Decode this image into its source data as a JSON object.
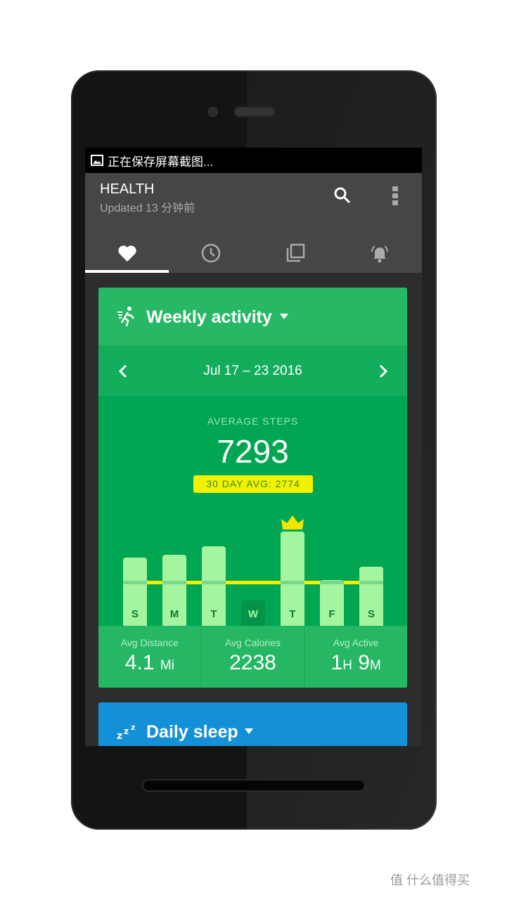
{
  "status_bar": {
    "notification": "正在保存屏幕截图...",
    "icon": "image-icon"
  },
  "app_bar": {
    "title": "HEALTH",
    "subtitle": "Updated 13 分钟前",
    "actions": [
      "search-icon",
      "more-vert-icon"
    ]
  },
  "tabs": [
    {
      "icon": "heart-icon",
      "selected": true
    },
    {
      "icon": "clock-icon",
      "selected": false
    },
    {
      "icon": "layers-icon",
      "selected": false
    },
    {
      "icon": "alarm-icon",
      "selected": false
    }
  ],
  "activity_card": {
    "title": "Weekly activity",
    "date_range": "Jul 17 – 23 2016",
    "average_label": "AVERAGE STEPS",
    "average_value": "7293",
    "thirty_day_badge": "30 DAY AVG: 2774",
    "colors": {
      "header": "#27b865",
      "body": "#00a651",
      "bar": "#a5f5a0",
      "avg_line": "#f2f200"
    },
    "stats": [
      {
        "label": "Avg Distance",
        "value": "4.1",
        "unit": "Mi"
      },
      {
        "label": "Avg Calories",
        "value": "2238",
        "unit": ""
      },
      {
        "label": "Avg Active",
        "value": "1",
        "unit": "H",
        "value2": "9",
        "unit2": "M"
      }
    ]
  },
  "chart_data": {
    "type": "bar",
    "categories": [
      "S",
      "M",
      "T",
      "W",
      "T",
      "F",
      "S"
    ],
    "values": [
      4340,
      4520,
      5050,
      1600,
      5990,
      2900,
      3760
    ],
    "reference_line": 2774,
    "highlight_max_index": 4,
    "today_index": 3
  },
  "sleep_card": {
    "title": "Daily sleep",
    "color": "#1490d8"
  },
  "watermark": "值 什么值得买"
}
